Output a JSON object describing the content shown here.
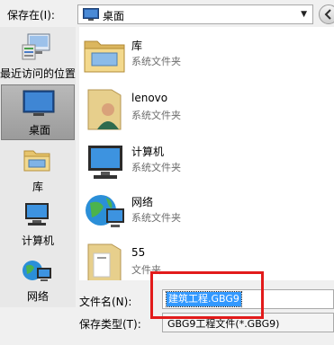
{
  "toolbar": {
    "save_in_label": "保存在(I):",
    "location_value": "桌面",
    "location_icon": "desktop-icon",
    "back_icon": "back-arrow-icon"
  },
  "places": [
    {
      "label": "最近访问的位置",
      "icon": "recent-places-icon",
      "selected": false
    },
    {
      "label": "桌面",
      "icon": "desktop-icon",
      "selected": true
    },
    {
      "label": "库",
      "icon": "library-icon",
      "selected": false
    },
    {
      "label": "计算机",
      "icon": "computer-icon",
      "selected": false
    },
    {
      "label": "网络",
      "icon": "network-icon",
      "selected": false
    }
  ],
  "files": [
    {
      "name": "库",
      "type": "系统文件夹",
      "icon": "library-folder-icon"
    },
    {
      "name": "lenovo",
      "type": "系统文件夹",
      "icon": "user-folder-icon"
    },
    {
      "name": "计算机",
      "type": "系统文件夹",
      "icon": "computer-icon"
    },
    {
      "name": "网络",
      "type": "系统文件夹",
      "icon": "network-icon"
    },
    {
      "name": "55",
      "type": "文件夹",
      "icon": "folder-icon"
    }
  ],
  "bottom": {
    "filename_label": "文件名(N):",
    "filename_value": "建筑工程.GBG9",
    "filetype_label": "保存类型(T):",
    "filetype_value": "GBG9工程文件(*.GBG9)"
  },
  "colors": {
    "selection": "#3399ff",
    "annotation": "#e21b1b"
  }
}
